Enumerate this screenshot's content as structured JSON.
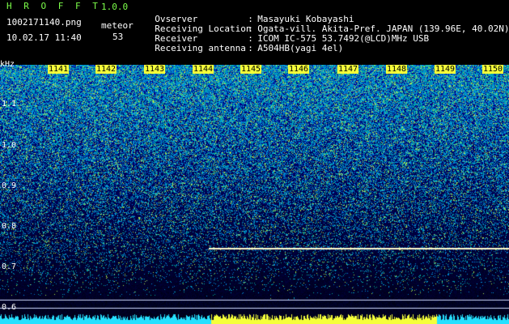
{
  "header": {
    "app_title": "H R O F F T",
    "version": "1.0.0",
    "filename": "1002171140.png",
    "timestamp": "10.02.17 11:40",
    "meteor_label": "meteor",
    "meteor_count": "53"
  },
  "info": [
    {
      "key": "Ovserver",
      "sep": ":",
      "value": "Masayuki Kobayashi"
    },
    {
      "key": "Receiving Location",
      "sep": ":",
      "value": "Ogata-vill. Akita-Pref. JAPAN (139.96E, 40.02N)"
    },
    {
      "key": "Receiver",
      "sep": ":",
      "value": "ICOM IC-575 53.7492(@LCD)MHz USB"
    },
    {
      "key": "Receiving antenna",
      "sep": ":",
      "value": "A504HB(yagi 4el)"
    }
  ],
  "axis": {
    "unit": "kHz",
    "y_labels": [
      "1.1",
      "1.0",
      "0.9",
      "0.8",
      "0.7",
      "0.6"
    ],
    "x_ticks": [
      "1141",
      "1142",
      "1143",
      "1144",
      "1145",
      "1146",
      "1147",
      "1148",
      "1149",
      "1150"
    ]
  },
  "colors": {
    "header_green": "#7cff4a",
    "tick_bg": "#f5ff3a",
    "trace": "#fffbd0"
  }
}
